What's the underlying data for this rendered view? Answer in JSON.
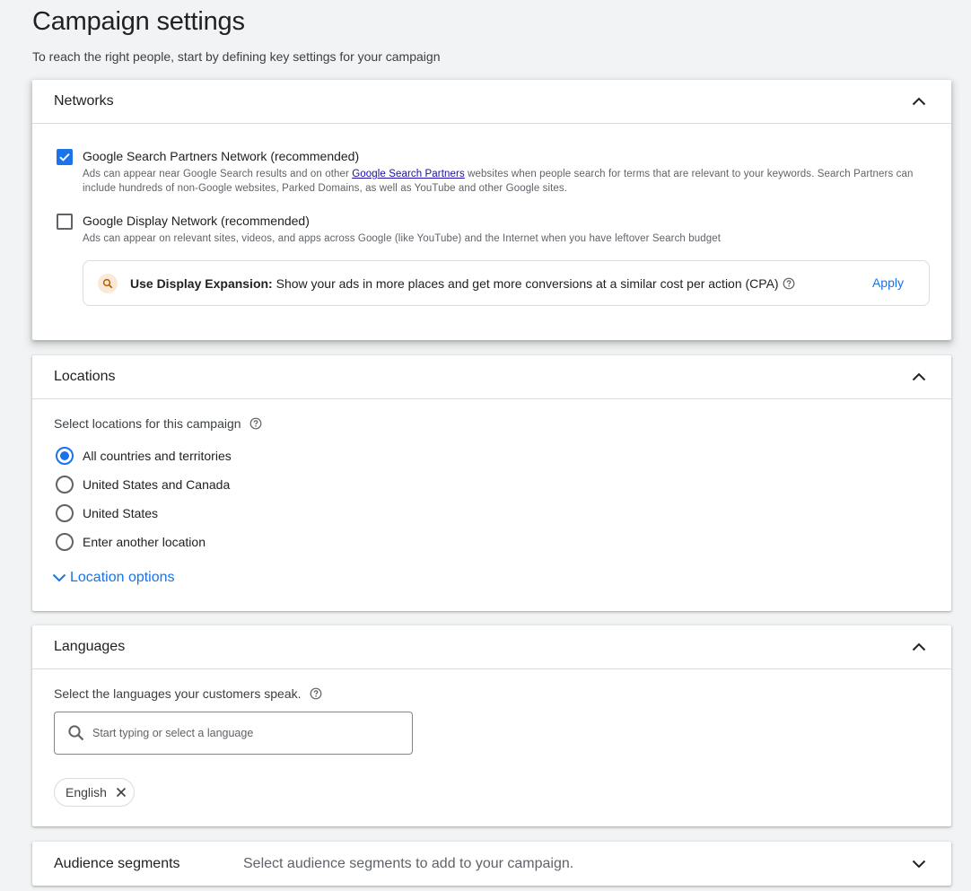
{
  "page": {
    "title": "Campaign settings",
    "subtitle": "To reach the right people, start by defining key settings for your campaign"
  },
  "networks": {
    "title": "Networks",
    "search_partners": {
      "label": "Google Search Partners Network (recommended)",
      "checked": true,
      "desc_prefix": "Ads can appear near Google Search results and on other ",
      "desc_link": "Google Search Partners",
      "desc_suffix": " websites when people search for terms that are relevant to your keywords. Search Partners can include hundreds of non-Google websites, Parked Domains, as well as YouTube and other Google sites."
    },
    "display_network": {
      "label": "Google Display Network (recommended)",
      "checked": false,
      "desc": "Ads can appear on relevant sites, videos, and apps across Google (like YouTube) and the Internet when you have leftover Search budget"
    },
    "expansion": {
      "bold": "Use Display Expansion:",
      "text": " Show your ads in more places and get more conversions at a similar cost per action (CPA)",
      "apply_label": "Apply"
    }
  },
  "locations": {
    "title": "Locations",
    "prompt": "Select locations for this campaign",
    "options": [
      {
        "label": "All countries and territories",
        "selected": true
      },
      {
        "label": "United States and Canada",
        "selected": false
      },
      {
        "label": "United States",
        "selected": false
      },
      {
        "label": "Enter another location",
        "selected": false
      }
    ],
    "more_label": "Location options"
  },
  "languages": {
    "title": "Languages",
    "prompt": "Select the languages your customers speak.",
    "search_placeholder": "Start typing or select a language",
    "selected": [
      "English"
    ]
  },
  "audience": {
    "title": "Audience segments",
    "desc": "Select audience segments to add to your campaign."
  },
  "colors": {
    "accent": "#1a73e8",
    "background": "#f1f3f4",
    "link": "#1a0dab"
  }
}
